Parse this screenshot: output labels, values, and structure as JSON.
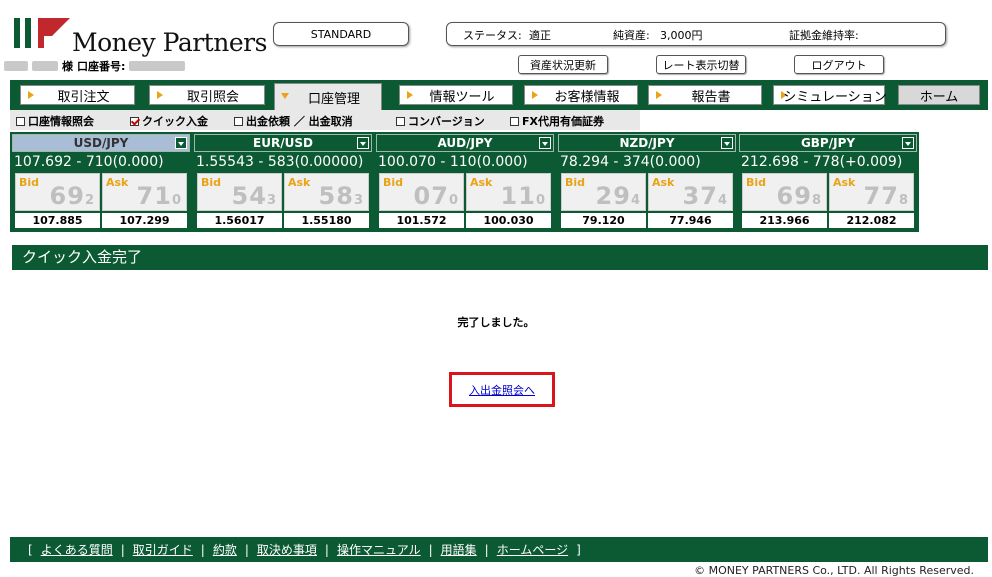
{
  "brand": {
    "name": "Money Partners",
    "logo_colors": [
      "#0b5a33",
      "#0b5a33",
      "#c0282d"
    ]
  },
  "account": {
    "suffix": "様",
    "account_label": "口座番号:"
  },
  "header": {
    "plan": "STANDARD",
    "status_label": "ステータス:",
    "status_value": "適正",
    "net_assets_label": "純資産:",
    "net_assets_value": "3,000円",
    "margin_ratio_label": "証拠金維持率:"
  },
  "buttons": {
    "refresh": "資産状況更新",
    "rate_switch": "レート表示切替",
    "logout": "ログアウト"
  },
  "nav": [
    "取引注文",
    "取引照会",
    "口座管理",
    "情報ツール",
    "お客様情報",
    "報告書",
    "シミュレーション",
    "ホーム"
  ],
  "subnav": [
    {
      "label": "口座情報照会",
      "checked": false
    },
    {
      "label": "クイック入金",
      "checked": true
    },
    {
      "label": "出金依頼 ／ 出金取消",
      "checked": false
    },
    {
      "label": "コンバージョン",
      "checked": false
    },
    {
      "label": "FX代用有価証券",
      "checked": false
    }
  ],
  "rates": [
    {
      "pair": "USD/JPY",
      "line": "107.692 - 710(0.000)",
      "bid_big": "69",
      "bid_small": "2",
      "ask_big": "71",
      "ask_small": "0",
      "high": "107.885",
      "low": "107.299"
    },
    {
      "pair": "EUR/USD",
      "line": "1.55543 - 583(0.00000)",
      "bid_big": "54",
      "bid_small": "3",
      "ask_big": "58",
      "ask_small": "3",
      "high": "1.56017",
      "low": "1.55180"
    },
    {
      "pair": "AUD/JPY",
      "line": "100.070 - 110(0.000)",
      "bid_big": "07",
      "bid_small": "0",
      "ask_big": "11",
      "ask_small": "0",
      "high": "101.572",
      "low": "100.030"
    },
    {
      "pair": "NZD/JPY",
      "line": " 78.294 - 374(0.000)",
      "bid_big": "29",
      "bid_small": "4",
      "ask_big": "37",
      "ask_small": "4",
      "high": "79.120",
      "low": "77.946"
    },
    {
      "pair": "GBP/JPY",
      "line": "212.698 - 778(+0.009)",
      "bid_big": "69",
      "bid_small": "8",
      "ask_big": "77",
      "ask_small": "8",
      "high": "213.966",
      "low": "212.082"
    }
  ],
  "labels": {
    "bid": "Bid",
    "ask": "Ask"
  },
  "content": {
    "title": "クイック入金完了",
    "message": "完了しました。",
    "link": "入出金照会へ"
  },
  "footer": {
    "open": "[",
    "close": "]",
    "links": [
      "よくある質問",
      "取引ガイド",
      "約款",
      "取決め事項",
      "操作マニュアル",
      "用語集",
      "ホームページ"
    ],
    "copyright": "© MONEY PARTNERS Co., LTD. All Rights Reserved."
  }
}
